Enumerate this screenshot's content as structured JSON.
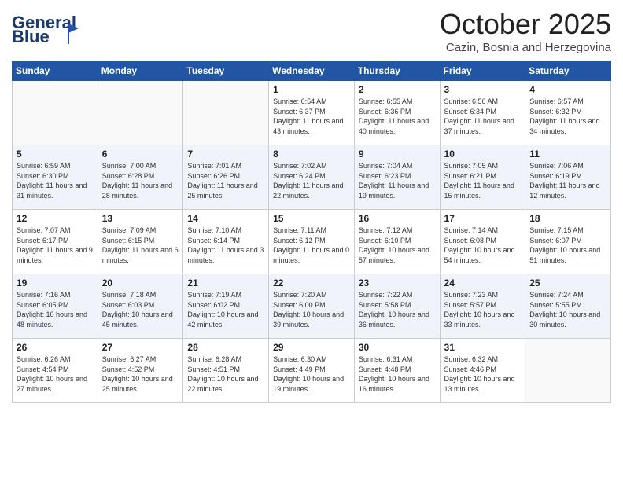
{
  "header": {
    "logo_line1": "General",
    "logo_line2": "Blue",
    "month": "October 2025",
    "location": "Cazin, Bosnia and Herzegovina"
  },
  "days_of_week": [
    "Sunday",
    "Monday",
    "Tuesday",
    "Wednesday",
    "Thursday",
    "Friday",
    "Saturday"
  ],
  "weeks": [
    [
      {
        "day": "",
        "info": ""
      },
      {
        "day": "",
        "info": ""
      },
      {
        "day": "",
        "info": ""
      },
      {
        "day": "1",
        "info": "Sunrise: 6:54 AM\nSunset: 6:37 PM\nDaylight: 11 hours\nand 43 minutes."
      },
      {
        "day": "2",
        "info": "Sunrise: 6:55 AM\nSunset: 6:36 PM\nDaylight: 11 hours\nand 40 minutes."
      },
      {
        "day": "3",
        "info": "Sunrise: 6:56 AM\nSunset: 6:34 PM\nDaylight: 11 hours\nand 37 minutes."
      },
      {
        "day": "4",
        "info": "Sunrise: 6:57 AM\nSunset: 6:32 PM\nDaylight: 11 hours\nand 34 minutes."
      }
    ],
    [
      {
        "day": "5",
        "info": "Sunrise: 6:59 AM\nSunset: 6:30 PM\nDaylight: 11 hours\nand 31 minutes."
      },
      {
        "day": "6",
        "info": "Sunrise: 7:00 AM\nSunset: 6:28 PM\nDaylight: 11 hours\nand 28 minutes."
      },
      {
        "day": "7",
        "info": "Sunrise: 7:01 AM\nSunset: 6:26 PM\nDaylight: 11 hours\nand 25 minutes."
      },
      {
        "day": "8",
        "info": "Sunrise: 7:02 AM\nSunset: 6:24 PM\nDaylight: 11 hours\nand 22 minutes."
      },
      {
        "day": "9",
        "info": "Sunrise: 7:04 AM\nSunset: 6:23 PM\nDaylight: 11 hours\nand 19 minutes."
      },
      {
        "day": "10",
        "info": "Sunrise: 7:05 AM\nSunset: 6:21 PM\nDaylight: 11 hours\nand 15 minutes."
      },
      {
        "day": "11",
        "info": "Sunrise: 7:06 AM\nSunset: 6:19 PM\nDaylight: 11 hours\nand 12 minutes."
      }
    ],
    [
      {
        "day": "12",
        "info": "Sunrise: 7:07 AM\nSunset: 6:17 PM\nDaylight: 11 hours\nand 9 minutes."
      },
      {
        "day": "13",
        "info": "Sunrise: 7:09 AM\nSunset: 6:15 PM\nDaylight: 11 hours\nand 6 minutes."
      },
      {
        "day": "14",
        "info": "Sunrise: 7:10 AM\nSunset: 6:14 PM\nDaylight: 11 hours\nand 3 minutes."
      },
      {
        "day": "15",
        "info": "Sunrise: 7:11 AM\nSunset: 6:12 PM\nDaylight: 11 hours\nand 0 minutes."
      },
      {
        "day": "16",
        "info": "Sunrise: 7:12 AM\nSunset: 6:10 PM\nDaylight: 10 hours\nand 57 minutes."
      },
      {
        "day": "17",
        "info": "Sunrise: 7:14 AM\nSunset: 6:08 PM\nDaylight: 10 hours\nand 54 minutes."
      },
      {
        "day": "18",
        "info": "Sunrise: 7:15 AM\nSunset: 6:07 PM\nDaylight: 10 hours\nand 51 minutes."
      }
    ],
    [
      {
        "day": "19",
        "info": "Sunrise: 7:16 AM\nSunset: 6:05 PM\nDaylight: 10 hours\nand 48 minutes."
      },
      {
        "day": "20",
        "info": "Sunrise: 7:18 AM\nSunset: 6:03 PM\nDaylight: 10 hours\nand 45 minutes."
      },
      {
        "day": "21",
        "info": "Sunrise: 7:19 AM\nSunset: 6:02 PM\nDaylight: 10 hours\nand 42 minutes."
      },
      {
        "day": "22",
        "info": "Sunrise: 7:20 AM\nSunset: 6:00 PM\nDaylight: 10 hours\nand 39 minutes."
      },
      {
        "day": "23",
        "info": "Sunrise: 7:22 AM\nSunset: 5:58 PM\nDaylight: 10 hours\nand 36 minutes."
      },
      {
        "day": "24",
        "info": "Sunrise: 7:23 AM\nSunset: 5:57 PM\nDaylight: 10 hours\nand 33 minutes."
      },
      {
        "day": "25",
        "info": "Sunrise: 7:24 AM\nSunset: 5:55 PM\nDaylight: 10 hours\nand 30 minutes."
      }
    ],
    [
      {
        "day": "26",
        "info": "Sunrise: 6:26 AM\nSunset: 4:54 PM\nDaylight: 10 hours\nand 27 minutes."
      },
      {
        "day": "27",
        "info": "Sunrise: 6:27 AM\nSunset: 4:52 PM\nDaylight: 10 hours\nand 25 minutes."
      },
      {
        "day": "28",
        "info": "Sunrise: 6:28 AM\nSunset: 4:51 PM\nDaylight: 10 hours\nand 22 minutes."
      },
      {
        "day": "29",
        "info": "Sunrise: 6:30 AM\nSunset: 4:49 PM\nDaylight: 10 hours\nand 19 minutes."
      },
      {
        "day": "30",
        "info": "Sunrise: 6:31 AM\nSunset: 4:48 PM\nDaylight: 10 hours\nand 16 minutes."
      },
      {
        "day": "31",
        "info": "Sunrise: 6:32 AM\nSunset: 4:46 PM\nDaylight: 10 hours\nand 13 minutes."
      },
      {
        "day": "",
        "info": ""
      }
    ]
  ]
}
